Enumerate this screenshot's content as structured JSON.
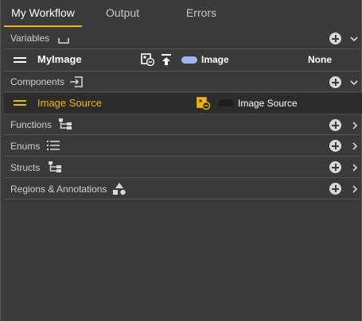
{
  "tabs": [
    {
      "label": "My Workflow",
      "active": true
    },
    {
      "label": "Output",
      "active": false
    },
    {
      "label": "Errors",
      "active": false
    }
  ],
  "sections": {
    "variables": {
      "label": "Variables",
      "icon": "bracket-icon",
      "expanded": true
    },
    "components": {
      "label": "Components",
      "icon": "import-icon",
      "expanded": true
    },
    "functions": {
      "label": "Functions",
      "icon": "hierarchy-icon",
      "expanded": false
    },
    "enums": {
      "label": "Enums",
      "icon": "list-icon",
      "expanded": false
    },
    "structs": {
      "label": "Structs",
      "icon": "hierarchy-icon",
      "expanded": false
    },
    "regions": {
      "label": "Regions & Annotations",
      "icon": "shapes-icon",
      "expanded": false
    }
  },
  "variable_item": {
    "name": "MyImage",
    "type_label": "Image",
    "type_color": "#a0b4f0",
    "value": "None"
  },
  "component_item": {
    "name": "Image Source",
    "type_label": "Image Source",
    "type_color": "#2a2a2a"
  },
  "colors": {
    "accent": "#f4b400",
    "background": "#3a3a3a",
    "divider": "#505050"
  }
}
